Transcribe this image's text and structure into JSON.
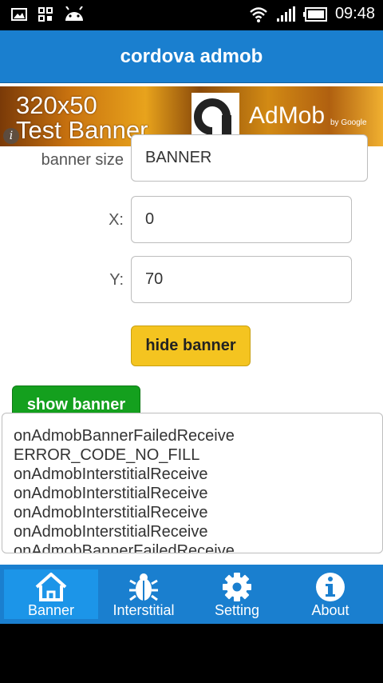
{
  "status_bar": {
    "icons_left": [
      "image-icon",
      "grid-icon",
      "android-icon"
    ],
    "icons_right": [
      "wifi-icon",
      "signal-icon",
      "battery-icon"
    ],
    "time": "09:48"
  },
  "header": {
    "title": "cordova admob"
  },
  "ad": {
    "line1": "320x50",
    "line2": "Test Banner",
    "brand": "AdMob",
    "by": "by Google",
    "info": "i"
  },
  "form": {
    "banner_size": {
      "label": "banner size",
      "value": "BANNER"
    },
    "x": {
      "label": "X:",
      "value": "0"
    },
    "y": {
      "label": "Y:",
      "value": "70"
    }
  },
  "buttons": {
    "hide": "hide banner",
    "show": "show banner"
  },
  "log": [
    "onAdmobBannerFailedReceive",
    "ERROR_CODE_NO_FILL",
    "onAdmobInterstitialReceive",
    "onAdmobInterstitialReceive",
    "onAdmobInterstitialReceive",
    "onAdmobInterstitialReceive",
    "onAdmobBannerFailedReceive"
  ],
  "tabs": [
    {
      "label": "Banner",
      "icon": "home-icon",
      "active": true
    },
    {
      "label": "Interstitial",
      "icon": "bug-icon",
      "active": false
    },
    {
      "label": "Setting",
      "icon": "gear-icon",
      "active": false
    },
    {
      "label": "About",
      "icon": "info-icon",
      "active": false
    }
  ],
  "colors": {
    "header": "#1a7fcf",
    "hide_button": "#f4c420",
    "show_button": "#14a01e",
    "active_tab": "#1c95e8"
  }
}
